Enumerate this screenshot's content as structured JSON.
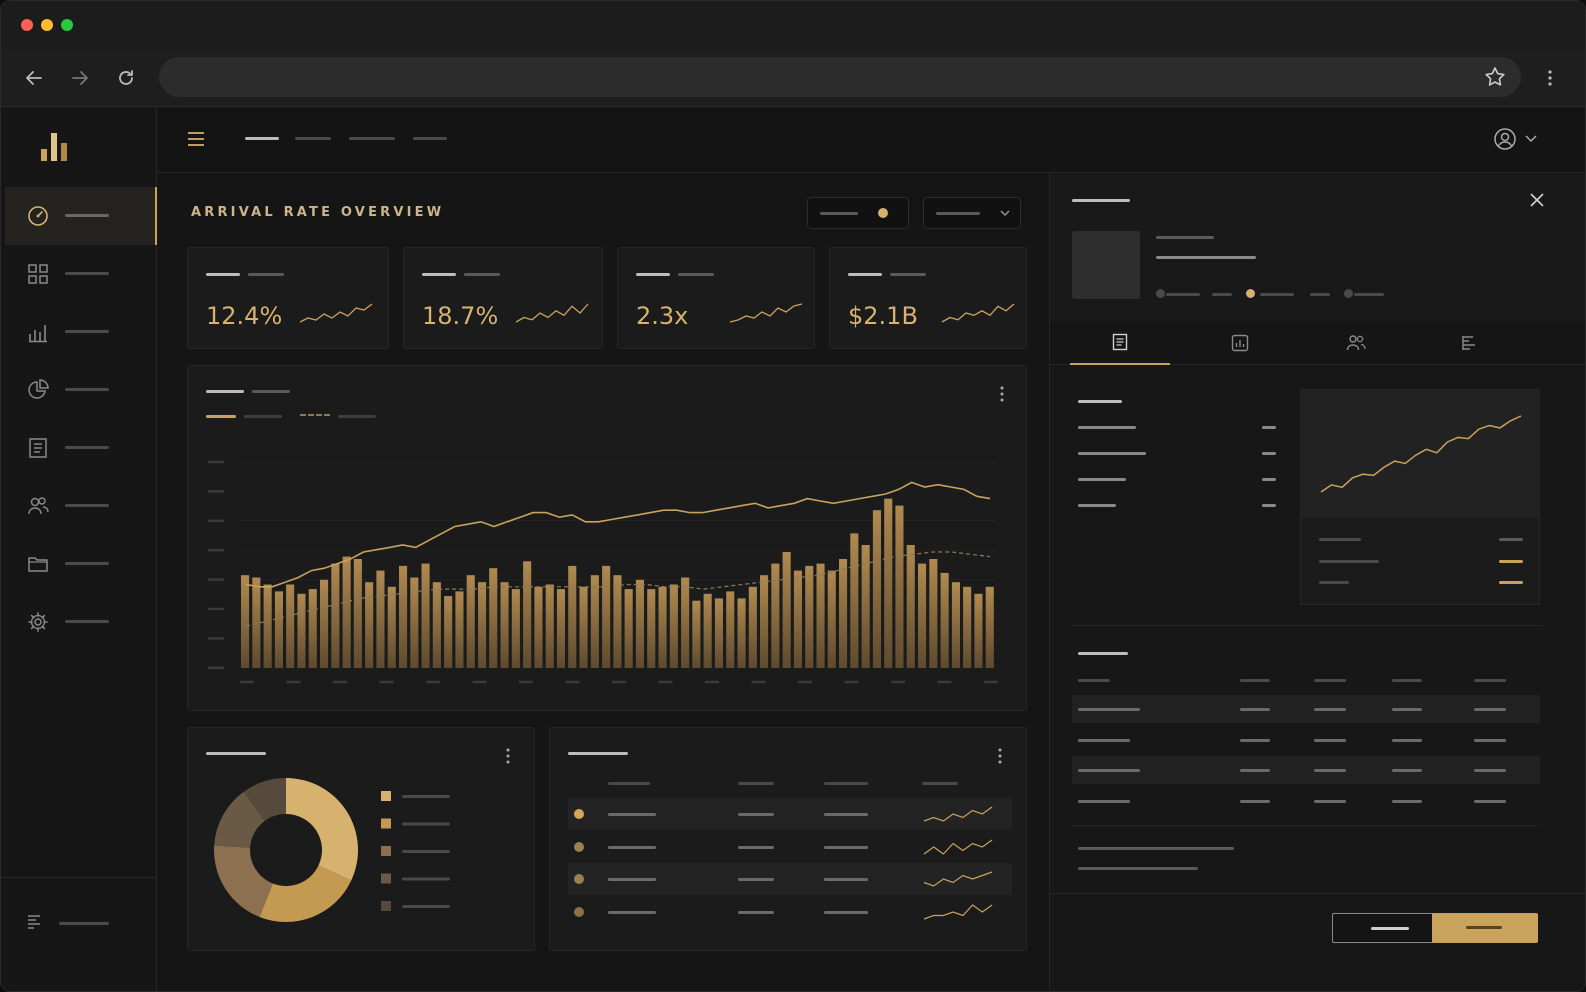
{
  "colors": {
    "accent": "#c9a25c",
    "accent_light": "#e0c48a",
    "background": "#141414",
    "card": "#1b1b1b",
    "placeholder": "#4a4a4a"
  },
  "browser": {
    "traffic_lights": [
      "#ff5f57",
      "#febc2e",
      "#28c840"
    ],
    "icons": [
      "back-arrow-icon",
      "forward-arrow-icon",
      "reload-icon",
      "star-icon",
      "kebab-menu-icon"
    ]
  },
  "sidebar": {
    "items": [
      {
        "icon": "gauge-icon",
        "active": true
      },
      {
        "icon": "grid-icon",
        "active": false
      },
      {
        "icon": "bar-chart-icon",
        "active": false
      },
      {
        "icon": "pie-chart-icon",
        "active": false
      },
      {
        "icon": "document-icon",
        "active": false
      },
      {
        "icon": "users-icon",
        "active": false
      },
      {
        "icon": "folder-icon",
        "active": false
      },
      {
        "icon": "gear-icon",
        "active": false
      }
    ],
    "footer_icon": "list-icon"
  },
  "main": {
    "title": "ARRIVAL RATE OVERVIEW",
    "kpis": [
      {
        "value": "12.4%",
        "spark": [
          4,
          6,
          5,
          8,
          6,
          9,
          7,
          11,
          10,
          13
        ]
      },
      {
        "value": "18.7%",
        "spark": [
          5,
          7,
          6,
          9,
          7,
          10,
          8,
          12,
          9,
          13
        ]
      },
      {
        "value": "2.3x",
        "spark": [
          4,
          5,
          7,
          6,
          9,
          7,
          11,
          9,
          12,
          13
        ]
      },
      {
        "value": "$2.1B",
        "spark": [
          5,
          7,
          6,
          9,
          8,
          10,
          8,
          12,
          10,
          13
        ]
      }
    ]
  },
  "chart_data": {
    "type": "bar",
    "values": [
      40,
      39,
      36,
      33,
      36,
      32,
      34,
      38,
      45,
      48,
      47,
      37,
      42,
      35,
      44,
      39,
      45,
      37,
      31,
      33,
      40,
      37,
      43,
      37,
      34,
      46,
      35,
      36,
      34,
      44,
      35,
      40,
      44,
      40,
      34,
      38,
      34,
      35,
      36,
      39,
      29,
      32,
      30,
      33,
      30,
      35,
      40,
      45,
      50,
      42,
      44,
      45,
      42,
      47,
      58,
      53,
      68,
      73,
      70,
      53,
      45,
      47,
      41,
      37,
      35,
      32,
      35
    ],
    "line": [
      36,
      35,
      35,
      37,
      39,
      42,
      43,
      45,
      47,
      50,
      51,
      52,
      53,
      52,
      55,
      58,
      61,
      62,
      63,
      61,
      63,
      65,
      67,
      67,
      65,
      66,
      63,
      63,
      64,
      65,
      66,
      67,
      68,
      68,
      67,
      67,
      68,
      69,
      70,
      71,
      69,
      70,
      71,
      73,
      72,
      71,
      72,
      73,
      74,
      75,
      77,
      80,
      78,
      79,
      78,
      77,
      74,
      73
    ],
    "dashed": [
      18,
      20,
      22,
      24,
      26,
      28,
      30,
      31,
      32,
      33,
      34,
      34,
      34,
      35,
      35,
      35,
      35,
      35,
      35,
      35,
      36,
      36,
      35,
      35,
      34,
      35,
      36,
      37,
      38,
      39,
      40,
      42,
      44,
      46,
      48,
      49,
      50,
      50,
      49,
      48
    ],
    "ylim": [
      0,
      100
    ]
  },
  "donut": {
    "segments": [
      {
        "value": 32,
        "color": "#d6b26e"
      },
      {
        "value": 24,
        "color": "#c49a52"
      },
      {
        "value": 20,
        "color": "#8c7050"
      },
      {
        "value": 14,
        "color": "#6a5a45"
      },
      {
        "value": 10,
        "color": "#564a3c"
      }
    ]
  },
  "table": {
    "rows": [
      {
        "dot": "#d6a55a",
        "spark": [
          5,
          6,
          5,
          7,
          6,
          8,
          7,
          9
        ]
      },
      {
        "dot": "#9a8050",
        "spark": [
          5,
          7,
          5,
          8,
          6,
          8,
          7,
          9
        ]
      },
      {
        "dot": "#9a8050",
        "spark": [
          6,
          5,
          7,
          6,
          8,
          7,
          8,
          9
        ]
      },
      {
        "dot": "#8a7248",
        "spark": [
          5,
          6,
          6,
          7,
          6,
          9,
          7,
          9
        ]
      }
    ]
  },
  "panel": {
    "tab_icons": [
      "document-icon",
      "report-chart-icon",
      "users-icon",
      "gantt-icon"
    ],
    "trend": [
      10,
      16,
      14,
      22,
      25,
      24,
      31,
      36,
      34,
      41,
      46,
      43,
      52,
      56,
      55,
      63,
      66,
      64,
      70,
      74
    ]
  }
}
